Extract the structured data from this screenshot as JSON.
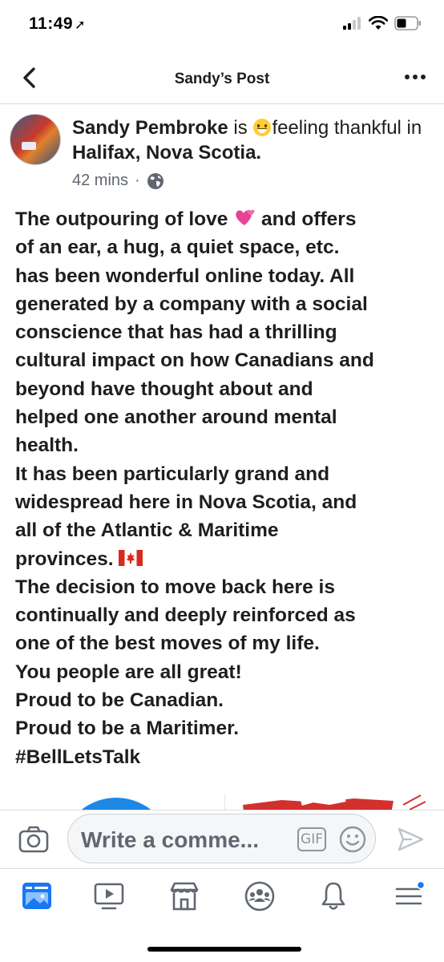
{
  "status_bar": {
    "time": "11:49",
    "location_icon": "location-arrow-icon",
    "signal_icon": "cell-signal-icon",
    "wifi_icon": "wifi-icon",
    "battery_icon": "battery-icon"
  },
  "nav": {
    "back_icon": "chevron-left-icon",
    "title": "Sandy’s Post",
    "more_icon": "more-horizontal-icon"
  },
  "post": {
    "author": "Sandy Pembroke",
    "is_text": "is",
    "feeling_emoji_icon": "grinning-face-emoji",
    "feeling_text": "feeling thankful in",
    "location": "Halifax, Nova Scotia.",
    "time_ago": "42 mins",
    "separator": "·",
    "privacy_icon": "globe-icon",
    "body_lines": [
      "The outpouring of love",
      "of an ear, a hug, a quiet space, etc.",
      "has been wonderful online today. All",
      "generated by a company with a social",
      "conscience that has had a thrilling",
      "cultural impact on how Canadians and",
      "beyond have thought about and",
      "helped one another around mental",
      "health.",
      "It has been particularly grand and",
      "widespread here in Nova Scotia, and",
      "all of the Atlantic & Maritime",
      "provinces.",
      "The decision to move back here is",
      "continually and deeply reinforced as",
      "one of the best moves of my life.",
      "You people are all great!",
      "Proud to be Canadian.",
      "Proud to be a Maritimer.",
      "#BellLetsTalk"
    ],
    "line1_after_emoji": "and offers",
    "heart_emoji_icon": "two-hearts-emoji",
    "flag_emoji_icon": "canada-flag-emoji"
  },
  "comment_bar": {
    "camera_icon": "camera-icon",
    "placeholder": "Write a comme...",
    "gif_label": "GIF",
    "emoji_icon": "smiley-icon",
    "send_icon": "send-icon"
  },
  "tabs": [
    {
      "name": "news-feed",
      "icon": "news-feed-icon"
    },
    {
      "name": "watch",
      "icon": "watch-icon"
    },
    {
      "name": "marketplace",
      "icon": "marketplace-icon"
    },
    {
      "name": "groups",
      "icon": "groups-icon"
    },
    {
      "name": "notifications",
      "icon": "bell-icon"
    },
    {
      "name": "menu",
      "icon": "menu-icon"
    }
  ],
  "colors": {
    "accent": "#1877f2",
    "text": "#1c1e21",
    "secondary_text": "#606770",
    "icon_gray": "#606770"
  }
}
